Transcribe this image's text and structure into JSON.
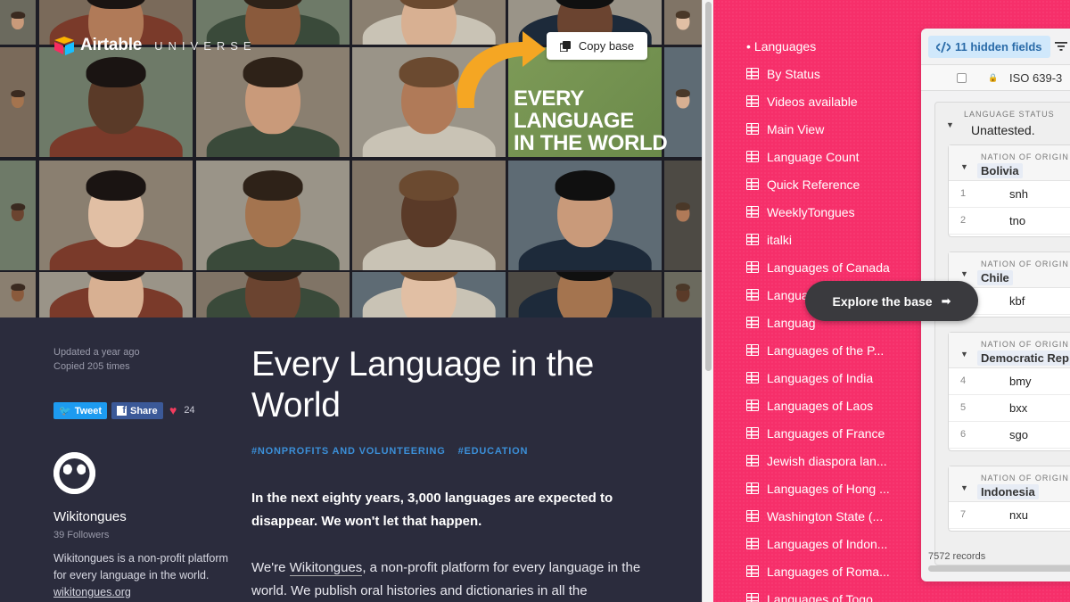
{
  "brand": {
    "name": "Airtable",
    "subbrand": "UNIVERSE"
  },
  "hero": {
    "overlay_lines": [
      "EVERY",
      "LANGUAGE",
      "IN THE WORLD"
    ],
    "copy_base_label": "Copy base"
  },
  "meta": {
    "updated": "Updated a year ago",
    "copied": "Copied 205 times"
  },
  "social": {
    "tweet_label": "Tweet",
    "share_label": "Share",
    "likes": "24"
  },
  "org": {
    "name": "Wikitongues",
    "followers": "39 Followers",
    "description": "Wikitongues is a non-profit platform for every language in the world.",
    "link": "wikitongues.org"
  },
  "base": {
    "title": "Every Language in the World",
    "tags": [
      "#NONPROFITS AND VOLUNTEERING",
      "#EDUCATION"
    ],
    "para1": "In the next eighty years, 3,000 languages are expected to disappear. We won't let that happen.",
    "para2_prefix": "We're ",
    "para2_link": "Wikitongues",
    "para2_suffix": ", a non-profit platform for every language in the world. We publish oral histories and dictionaries in all the"
  },
  "views": {
    "selected": "Languages",
    "items": [
      "By Status",
      "Videos available",
      "Main View",
      "Language Count",
      "Quick Reference",
      "WeeklyTongues",
      "italki",
      "Languages of Canada",
      "Langua",
      "Languag",
      "Languages of the P...",
      "Languages of India",
      "Languages of Laos",
      "Languages of France",
      "Jewish diaspora lan...",
      "Languages of Hong ...",
      "Washington State (...",
      "Languages of Indon...",
      "Languages of Roma...",
      "Languages of Togo"
    ]
  },
  "grid": {
    "hidden_fields_label": "11 hidden fields",
    "column_name": "ISO 639-3",
    "status_caption": "LANGUAGE STATUS",
    "status_value": "Unattested.",
    "nation_caption": "NATION OF ORIGIN",
    "groups": [
      {
        "name": "Bolivia",
        "rows": [
          {
            "num": "1",
            "code": "snh"
          },
          {
            "num": "2",
            "code": "tno"
          }
        ]
      },
      {
        "name": "Chile",
        "rows": [
          {
            "num": "",
            "code": "kbf"
          }
        ]
      },
      {
        "name": "Democratic Rep",
        "rows": [
          {
            "num": "4",
            "code": "bmy"
          },
          {
            "num": "5",
            "code": "bxx"
          },
          {
            "num": "6",
            "code": "sgo"
          }
        ]
      },
      {
        "name": "Indonesia",
        "rows": [
          {
            "num": "7",
            "code": "nxu"
          }
        ]
      }
    ],
    "records": "7572 records"
  },
  "explore_label": "Explore the base",
  "colors": {
    "accent_pink": "#f62f6a",
    "dark_bg": "#2b2c3d",
    "tag_blue": "#3b8fd8",
    "arrow_orange": "#f5a623"
  },
  "icons": [
    "airtable-logo-icon",
    "copy-icon",
    "twitter-icon",
    "facebook-icon",
    "heart-icon",
    "wikitongues-logo-icon",
    "grid-view-icon",
    "hidden-fields-icon",
    "filter-icon",
    "lock-icon",
    "collapse-triangle-icon",
    "arrow-right-icon"
  ]
}
